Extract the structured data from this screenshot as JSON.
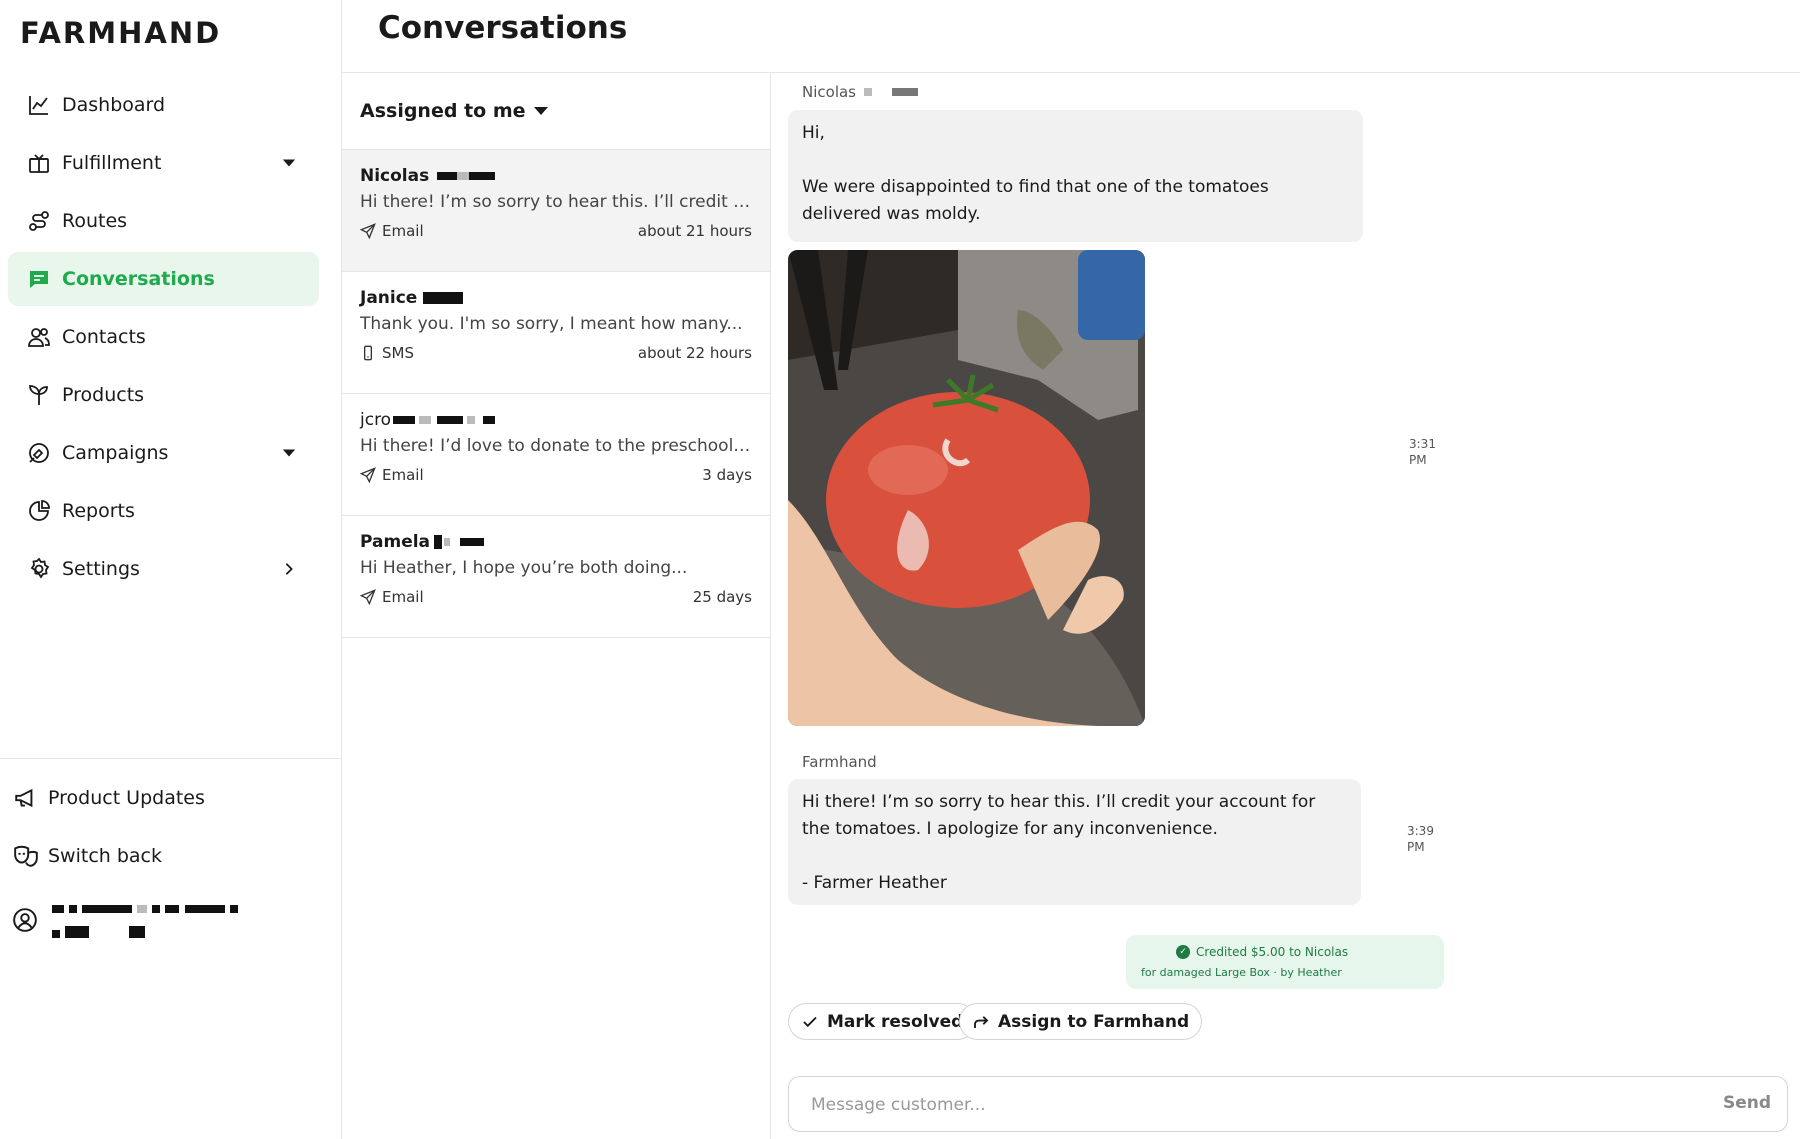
{
  "app": {
    "logo": "FARMHAND"
  },
  "sidebar": {
    "items": [
      {
        "label": "Dashboard",
        "icon": "chart-line-icon"
      },
      {
        "label": "Fulfillment",
        "icon": "box-icon",
        "caret": "down"
      },
      {
        "label": "Routes",
        "icon": "route-icon"
      },
      {
        "label": "Conversations",
        "icon": "message-icon",
        "active": true
      },
      {
        "label": "Contacts",
        "icon": "users-icon"
      },
      {
        "label": "Products",
        "icon": "sprout-icon"
      },
      {
        "label": "Campaigns",
        "icon": "megaphone-swirl-icon",
        "caret": "down"
      },
      {
        "label": "Reports",
        "icon": "pie-chart-icon"
      },
      {
        "label": "Settings",
        "icon": "gear-icon",
        "caret": "right"
      }
    ],
    "bottom": [
      {
        "label": "Product Updates",
        "icon": "megaphone-icon"
      },
      {
        "label": "Switch back",
        "icon": "masks-icon"
      }
    ]
  },
  "page": {
    "title": "Conversations"
  },
  "list": {
    "filter_label": "Assigned to me",
    "conversations": [
      {
        "name": "Nicolas",
        "preview": "Hi there! I’m so sorry to hear this. I’ll credit yo...",
        "channel": "Email",
        "time": "about 21 hours",
        "selected": true
      },
      {
        "name": "Janice",
        "preview": "Thank you. I'm so sorry, I meant how many...",
        "channel": "SMS",
        "time": "about 22 hours"
      },
      {
        "name": "jcro",
        "preview": "Hi there! I’d love to donate to the preschool. W...",
        "channel": "Email",
        "time": "3 days"
      },
      {
        "name": "Pamela",
        "preview": "Hi Heather, I hope you’re both doing...",
        "channel": "Email",
        "time": "25 days"
      }
    ]
  },
  "thread": {
    "customer_name": "Nicolas",
    "customer_message_line1": "Hi,",
    "customer_message_line2": "We were disappointed to find that one of the tomatoes delivered was moldy.",
    "customer_time_1": "3:31",
    "customer_time_2": "PM",
    "farm_name": "Farmhand",
    "reply_line1": "Hi there! I’m so sorry to hear this. I’ll credit your account for the tomatoes. I apologize for any inconvenience.",
    "reply_line2": "- Farmer Heather",
    "reply_time_1": "3:39",
    "reply_time_2": "PM",
    "credit_line1": "Credited $5.00 to Nicolas",
    "credit_line2": "for damaged Large Box · by Heather",
    "mark_resolved": "Mark resolved",
    "assign": "Assign to Farmhand",
    "composer_placeholder": "Message customer...",
    "send": "Send"
  },
  "colors": {
    "accent": "#1faa4e",
    "active_bg": "#e8f6ec",
    "bubble": "#f1f1f1",
    "credit_bg": "#e6f6ec",
    "credit_text": "#1f7a44"
  }
}
